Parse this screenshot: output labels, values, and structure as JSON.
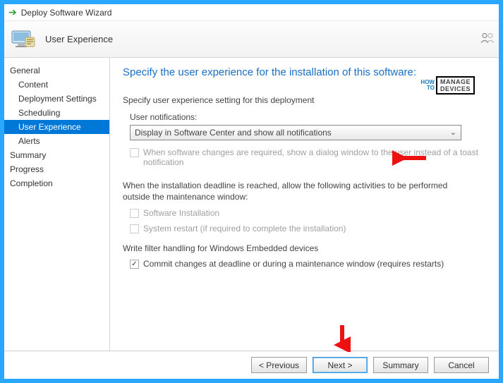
{
  "titlebar": {
    "title": "Deploy Software Wizard"
  },
  "header": {
    "page_name": "User Experience"
  },
  "sidebar": {
    "items": [
      {
        "label": "General",
        "sub": false
      },
      {
        "label": "Content",
        "sub": true
      },
      {
        "label": "Deployment Settings",
        "sub": true
      },
      {
        "label": "Scheduling",
        "sub": true
      },
      {
        "label": "User Experience",
        "sub": true,
        "selected": true
      },
      {
        "label": "Alerts",
        "sub": true
      },
      {
        "label": "Summary",
        "sub": false
      },
      {
        "label": "Progress",
        "sub": false
      },
      {
        "label": "Completion",
        "sub": false
      }
    ]
  },
  "content": {
    "heading": "Specify the user experience for the installation of this software:",
    "setting_label": "Specify user experience setting for this deployment",
    "user_notifications_label": "User notifications:",
    "user_notifications_value": "Display in Software Center and show all notifications",
    "dialog_checkbox": "When software changes are required, show a dialog window to the user instead of a toast notification",
    "deadline_paragraph": "When the installation deadline is reached, allow the following activities to be performed outside the maintenance window:",
    "software_install_checkbox": "Software Installation",
    "system_restart_checkbox": "System restart  (if required to complete the installation)",
    "write_filter_label": "Write filter handling for Windows Embedded devices",
    "commit_checkbox": "Commit changes at deadline or during a maintenance window (requires restarts)"
  },
  "watermark": {
    "how": "HOW",
    "to": "TO",
    "manage": "MANAGE",
    "devices": "DEVICES"
  },
  "buttons": {
    "previous": "<  Previous",
    "next": "Next  >",
    "summary": "Summary",
    "cancel": "Cancel"
  }
}
